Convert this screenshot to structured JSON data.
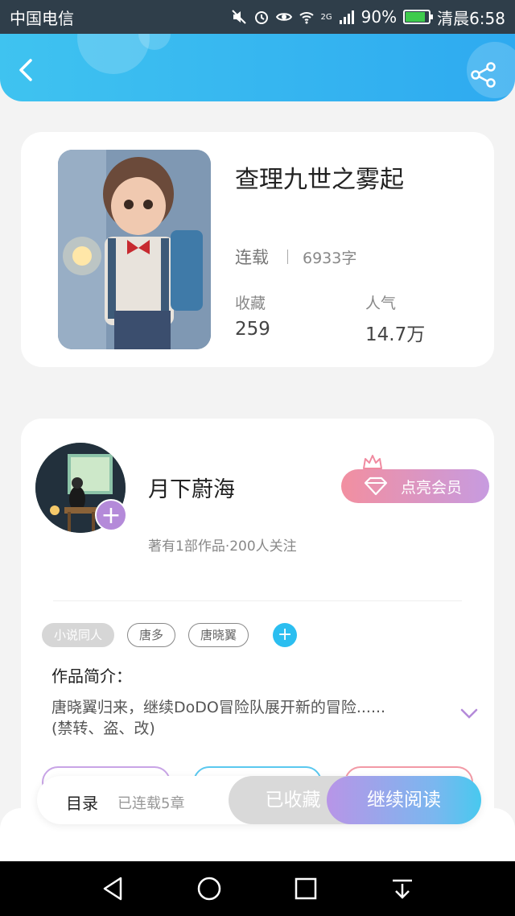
{
  "status_bar": {
    "carrier": "中国电信",
    "network": "2G",
    "battery": "90%",
    "time": "清晨6:58"
  },
  "header": {
    "back_icon": "chevron-left-icon",
    "share_icon": "share-icon"
  },
  "book": {
    "title": "查理九世之雾起",
    "status": "连载",
    "word_count": "6933字",
    "favorites_label": "收藏",
    "favorites_value": "259",
    "popularity_label": "人气",
    "popularity_value": "14.7万"
  },
  "author": {
    "name": "月下蔚海",
    "meta": "著有1部作品·200人关注",
    "follow_symbol": "+",
    "vip_label": "点亮会员"
  },
  "tags": [
    "小说同人",
    "唐多",
    "唐晓翼"
  ],
  "tag_add_symbol": "+",
  "intro": {
    "label": "作品简介：",
    "text": "唐晓翼归来，继续DoDO冒险队展开新的冒险......",
    "text2": "(禁转、盗、改)"
  },
  "actions": {
    "toc_label": "目录",
    "toc_status": "已连载5章",
    "collected_label": "已收藏",
    "read_label": "继续阅读"
  },
  "colors": {
    "header": "#3fc3f0",
    "accent_purple": "#b48ad9",
    "accent_blue": "#2bbef0"
  }
}
